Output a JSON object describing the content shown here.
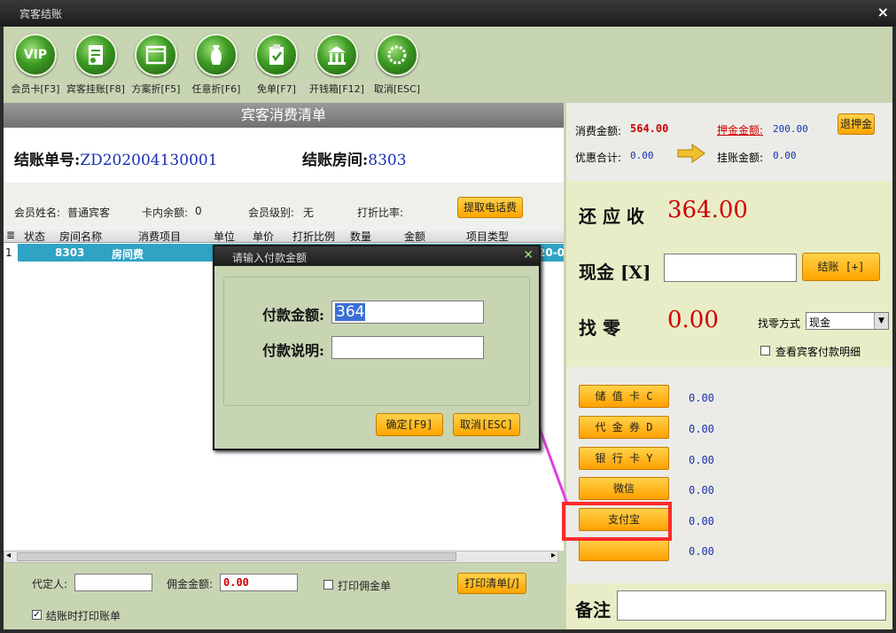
{
  "window": {
    "title": "宾客结账",
    "close_icon": "×"
  },
  "toolbar": [
    {
      "name": "vip",
      "icon": "VIP",
      "label": "会员卡[F3]"
    },
    {
      "name": "guest-charge",
      "icon": "bill",
      "label": "宾客挂账[F8]"
    },
    {
      "name": "plan-discount",
      "icon": "window",
      "label": "方案折[F5]"
    },
    {
      "name": "any-discount",
      "icon": "vase",
      "label": "任意折[F6]"
    },
    {
      "name": "free-bill",
      "icon": "clipboard-check",
      "label": "免单[F7]"
    },
    {
      "name": "open-drawer",
      "icon": "cash-drawer",
      "label": "开钱箱[F12]"
    },
    {
      "name": "cancel",
      "icon": "circle-dots",
      "label": "取消[ESC]"
    }
  ],
  "left": {
    "section_title": "宾客消费清单",
    "bill_no_label": "结账单号:",
    "bill_no": "ZD202004130001",
    "room_label": "结账房间:",
    "room": "8303",
    "member_name_label": "会员姓名:",
    "member_name": "普通宾客",
    "card_balance_label": "卡内余额:",
    "card_balance": "0",
    "member_level_label": "会员级别:",
    "member_level": "无",
    "discount_rate_label": "打折比率:",
    "discount_rate": "",
    "fetch_phone_button": "提取电话费",
    "grid": {
      "columns": [
        "状态",
        "房间名称",
        "消费项目",
        "单位",
        "单价",
        "打折比例",
        "数量",
        "金额",
        "项目类型"
      ],
      "rows": [
        {
          "num": "1",
          "status": "",
          "room": "8303",
          "item": "房间费",
          "tail": "20-0"
        }
      ]
    },
    "booker_label": "代定人:",
    "booker_value": "",
    "commission_label": "佣金金额:",
    "commission_value": "0.00",
    "print_commission_label": "打印佣金单",
    "print_list_button": "打印清单[/]",
    "print_on_checkout_label": "结账时打印账单",
    "print_on_checkout_checked": "✓"
  },
  "right": {
    "consume_label": "消费金额:",
    "consume_value": "564.00",
    "deposit_label": "押金金额:",
    "deposit_value": "200.00",
    "refund_deposit_button": "退押金",
    "discount_total_label": "优惠合计:",
    "discount_total_value": "0.00",
    "charged_label": "挂账金额:",
    "charged_value": "0.00",
    "due_label": "还 应 收",
    "due_value": "364.00",
    "cash_label": "现金 [X]",
    "cash_value": "",
    "checkout_button": "结账 [+]",
    "change_label": "找   零",
    "change_value": "0.00",
    "change_method_label": "找零方式",
    "change_method_value": "现金",
    "view_detail_label": "查看宾客付款明细",
    "payments": [
      {
        "label": "储 值 卡 C",
        "value": "0.00"
      },
      {
        "label": "代 金 券 D",
        "value": "0.00"
      },
      {
        "label": "银 行 卡 Y",
        "value": "0.00"
      },
      {
        "label": "微信",
        "value": "0.00"
      },
      {
        "label": "支付宝",
        "value": "0.00"
      },
      {
        "label": "",
        "value": "0.00"
      }
    ],
    "remark_label": "备注",
    "remark_value": ""
  },
  "dialog": {
    "title": "请输入付款金额",
    "amount_label": "付款金额:",
    "amount_value": "364",
    "note_label": "付款说明:",
    "note_value": "",
    "confirm_button": "确定[F9]",
    "cancel_button": "取消[ESC]"
  },
  "colors": {
    "accent": "#ffa500",
    "panel": "#c8d5b3",
    "highlight": "#ff2a2a",
    "arrow": "#e040e0"
  }
}
